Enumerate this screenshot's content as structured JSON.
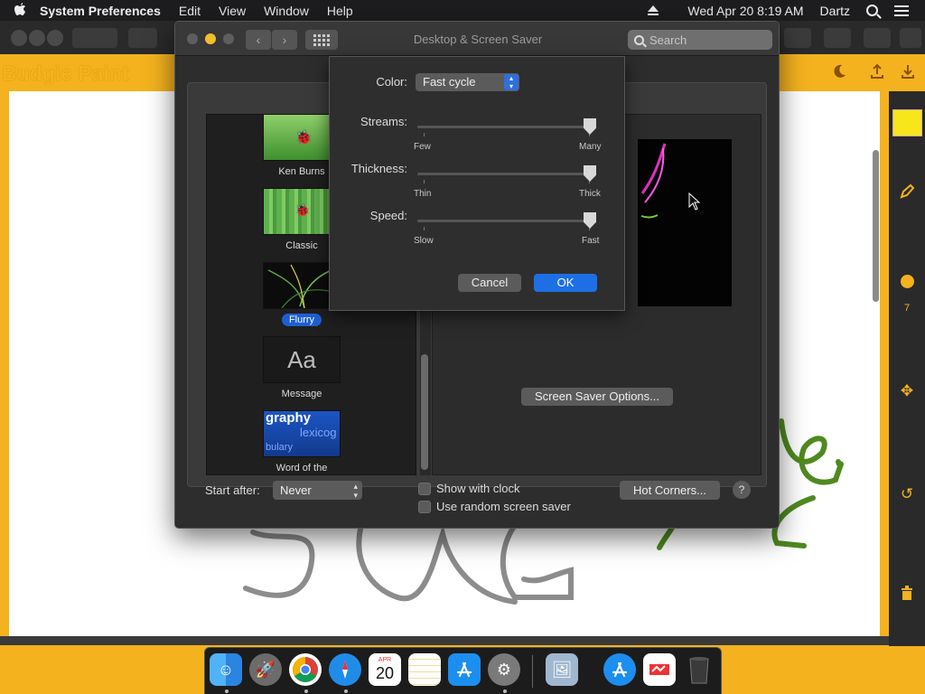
{
  "menubar": {
    "apple_icon": "apple-logo-icon",
    "app_name": "System Preferences",
    "menus": [
      "Edit",
      "View",
      "Window",
      "Help"
    ],
    "datetime": "Wed Apr 20  8:19 AM",
    "user": "Dartz"
  },
  "paint": {
    "title": "Budgie Paint",
    "brush_size": "7",
    "colors": {
      "accent": "#f4b21e",
      "swatch": "#f6e61a",
      "stroke_gray": "#8c8c8c",
      "stroke_green": "#4f8a1f"
    }
  },
  "window": {
    "title": "Desktop & Screen Saver",
    "search_placeholder": "Search"
  },
  "savers": [
    {
      "label": "Ken Burns"
    },
    {
      "label": "Classic"
    },
    {
      "label": "Flurry",
      "selected": true
    },
    {
      "label": "Message",
      "thumb_text": "Aa"
    },
    {
      "label": "Word of the Day",
      "thumb_word": "graphy",
      "thumb_sub": "lexicog",
      "thumb_sub2": "bulary"
    }
  ],
  "preview": {
    "options_button": "Screen Saver Options..."
  },
  "bottom": {
    "start_after_label": "Start after:",
    "start_after_value": "Never",
    "show_with_clock": "Show with clock",
    "random_saver": "Use random screen saver",
    "hot_corners": "Hot Corners...",
    "help": "?"
  },
  "sheet": {
    "color_label": "Color:",
    "color_value": "Fast cycle",
    "sliders": [
      {
        "label": "Streams:",
        "min_label": "Few",
        "max_label": "Many",
        "value": 1.0
      },
      {
        "label": "Thickness:",
        "min_label": "Thin",
        "max_label": "Thick",
        "value": 1.0
      },
      {
        "label": "Speed:",
        "min_label": "Slow",
        "max_label": "Fast",
        "value": 1.0
      }
    ],
    "cancel": "Cancel",
    "ok": "OK"
  },
  "dock": {
    "apps": [
      "finder-icon",
      "launchpad-icon",
      "chrome-icon",
      "safari-icon",
      "calendar-icon",
      "notes-icon",
      "app-store-icon",
      "system-preferences-icon",
      "preview-icon",
      "app-store-icon",
      "budgie-paint-icon",
      "trash-icon"
    ],
    "calendar_month": "APR",
    "calendar_day": "20"
  }
}
